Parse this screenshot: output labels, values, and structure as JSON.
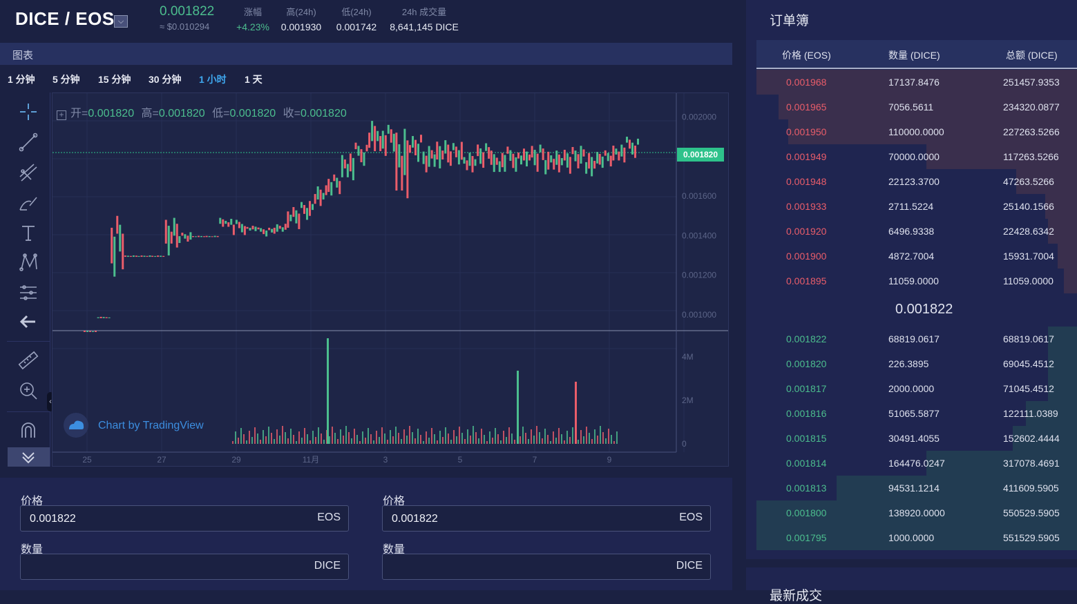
{
  "header": {
    "pair": "DICE / EOS",
    "dropdown_glyph": "⌵",
    "price": "0.001822",
    "price_usd": "≈ $0.010294",
    "stats": [
      {
        "label": "涨幅",
        "value": "+4.23%",
        "color": "#4cbe8e"
      },
      {
        "label": "高(24h)",
        "value": "0.001930",
        "color": "#e8ebf4"
      },
      {
        "label": "低(24h)",
        "value": "0.001742",
        "color": "#e8ebf4"
      },
      {
        "label": "24h 成交量",
        "value": "8,641,145 DICE",
        "color": "#e8ebf4"
      }
    ]
  },
  "chart_panel": {
    "title": "图表",
    "intervals": [
      {
        "label": "1 分钟",
        "active": false
      },
      {
        "label": "5 分钟",
        "active": false
      },
      {
        "label": "15 分钟",
        "active": false
      },
      {
        "label": "30 分钟",
        "active": false
      },
      {
        "label": "1 小时",
        "active": true
      },
      {
        "label": "1 天",
        "active": false
      }
    ],
    "tools": [
      "crosshair-icon",
      "trendline-icon",
      "pitchfork-icon",
      "brush-icon",
      "text-icon",
      "pattern-icon",
      "fib-icon",
      "back-arrow-icon",
      "ruler-icon",
      "zoom-in-icon",
      "magnet-icon",
      "hide-drawings-icon"
    ],
    "ohlc": {
      "open_label": "开=",
      "open": "0.001820",
      "high_label": "高=",
      "high": "0.001820",
      "low_label": "低=",
      "low": "0.001820",
      "close_label": "收=",
      "close": "0.001820"
    },
    "current_price_label": "0.001820",
    "watermark": "Chart by TradingView",
    "collapse_glyph": "‹"
  },
  "chart_data": {
    "type": "line",
    "title": "",
    "x_ticks": [
      "25",
      "27",
      "29",
      "11月",
      "3",
      "5",
      "7",
      "9"
    ],
    "price_ticks": [
      "0.002000",
      "0.001600",
      "0.001400",
      "0.001200",
      "0.001000"
    ],
    "volume_ticks": [
      "4M",
      "2M",
      "0"
    ],
    "current_price": 0.00182,
    "price_ylim": [
      0.00092,
      0.00212
    ],
    "series": [
      {
        "values": [
          [
            0.00092,
            0.00092
          ],
          [
            0.00099,
            0.00099
          ],
          [
            0.0012,
            0.0015
          ],
          [
            0.0013,
            0.0013
          ],
          [
            0.0013,
            0.0013
          ],
          [
            0.0013,
            0.0013
          ],
          [
            0.0013,
            0.0015
          ],
          [
            0.00137,
            0.00142
          ],
          [
            0.0014,
            0.0014
          ],
          [
            0.0014,
            0.0014
          ],
          [
            0.00144,
            0.00149
          ],
          [
            0.00141,
            0.00148
          ],
          [
            0.00142,
            0.00145
          ],
          [
            0.0014,
            0.00144
          ],
          [
            0.00141,
            0.00146
          ],
          [
            0.00144,
            0.00155
          ],
          [
            0.00148,
            0.00158
          ],
          [
            0.00155,
            0.00166
          ],
          [
            0.00161,
            0.00172
          ],
          [
            0.00168,
            0.00183
          ],
          [
            0.00176,
            0.00187
          ],
          [
            0.00181,
            0.00198
          ],
          [
            0.00181,
            0.00196
          ],
          [
            0.00155,
            0.00194
          ],
          [
            0.00178,
            0.00191
          ],
          [
            0.00172,
            0.00186
          ],
          [
            0.00174,
            0.00189
          ],
          [
            0.00176,
            0.00188
          ],
          [
            0.00172,
            0.00183
          ],
          [
            0.00175,
            0.00188
          ],
          [
            0.00171,
            0.00183
          ],
          [
            0.00173,
            0.00185
          ],
          [
            0.00174,
            0.00184
          ],
          [
            0.00173,
            0.00186
          ],
          [
            0.00171,
            0.00183
          ],
          [
            0.00172,
            0.00184
          ],
          [
            0.00174,
            0.00186
          ],
          [
            0.0017,
            0.00183
          ],
          [
            0.00175,
            0.00184
          ],
          [
            0.00177,
            0.00187
          ],
          [
            0.0018,
            0.0019
          ]
        ]
      }
    ]
  },
  "trade": {
    "left": {
      "price_label": "价格",
      "price_value": "0.001822",
      "price_unit": "EOS",
      "amount_label": "数量",
      "amount_value": "",
      "amount_unit": "DICE"
    },
    "right": {
      "price_label": "价格",
      "price_value": "0.001822",
      "price_unit": "EOS",
      "amount_label": "数量",
      "amount_value": "",
      "amount_unit": "DICE"
    }
  },
  "orderbook": {
    "title": "订单簿",
    "headers": [
      "价格 (EOS)",
      "数量 (DICE)",
      "总额 (DICE)"
    ],
    "asks": [
      {
        "price": "0.001968",
        "amount": "17137.8476",
        "total": "251457.9353",
        "depth": 1.0
      },
      {
        "price": "0.001965",
        "amount": "7056.5611",
        "total": "234320.0877",
        "depth": 0.93
      },
      {
        "price": "0.001950",
        "amount": "110000.0000",
        "total": "227263.5266",
        "depth": 0.9
      },
      {
        "price": "0.001949",
        "amount": "70000.0000",
        "total": "117263.5266",
        "depth": 0.47
      },
      {
        "price": "0.001948",
        "amount": "22123.3700",
        "total": "47263.5266",
        "depth": 0.19
      },
      {
        "price": "0.001933",
        "amount": "2711.5224",
        "total": "25140.1566",
        "depth": 0.1
      },
      {
        "price": "0.001920",
        "amount": "6496.9338",
        "total": "22428.6342",
        "depth": 0.09
      },
      {
        "price": "0.001900",
        "amount": "4872.7004",
        "total": "15931.7004",
        "depth": 0.06
      },
      {
        "price": "0.001895",
        "amount": "11059.0000",
        "total": "11059.0000",
        "depth": 0.04
      }
    ],
    "mid_price": "0.001822",
    "bids": [
      {
        "price": "0.001822",
        "amount": "68819.0617",
        "total": "68819.0617",
        "depth": 0.09
      },
      {
        "price": "0.001820",
        "amount": "226.3895",
        "total": "69045.4512",
        "depth": 0.09
      },
      {
        "price": "0.001817",
        "amount": "2000.0000",
        "total": "71045.4512",
        "depth": 0.09
      },
      {
        "price": "0.001816",
        "amount": "51065.5877",
        "total": "122111.0389",
        "depth": 0.16
      },
      {
        "price": "0.001815",
        "amount": "30491.4055",
        "total": "152602.4444",
        "depth": 0.2
      },
      {
        "price": "0.001814",
        "amount": "164476.0247",
        "total": "317078.4691",
        "depth": 0.47
      },
      {
        "price": "0.001813",
        "amount": "94531.1214",
        "total": "411609.5905",
        "depth": 0.75
      },
      {
        "price": "0.001800",
        "amount": "138920.0000",
        "total": "550529.5905",
        "depth": 1.0
      },
      {
        "price": "0.001795",
        "amount": "1000.0000",
        "total": "551529.5905",
        "depth": 1.0
      }
    ]
  },
  "latest_trades": {
    "title": "最新成交"
  },
  "colors": {
    "up": "#4cbe8e",
    "down": "#ea5d6a",
    "bg": "#1b2142",
    "panel": "#1f2550",
    "accent": "#3fa8ef"
  }
}
